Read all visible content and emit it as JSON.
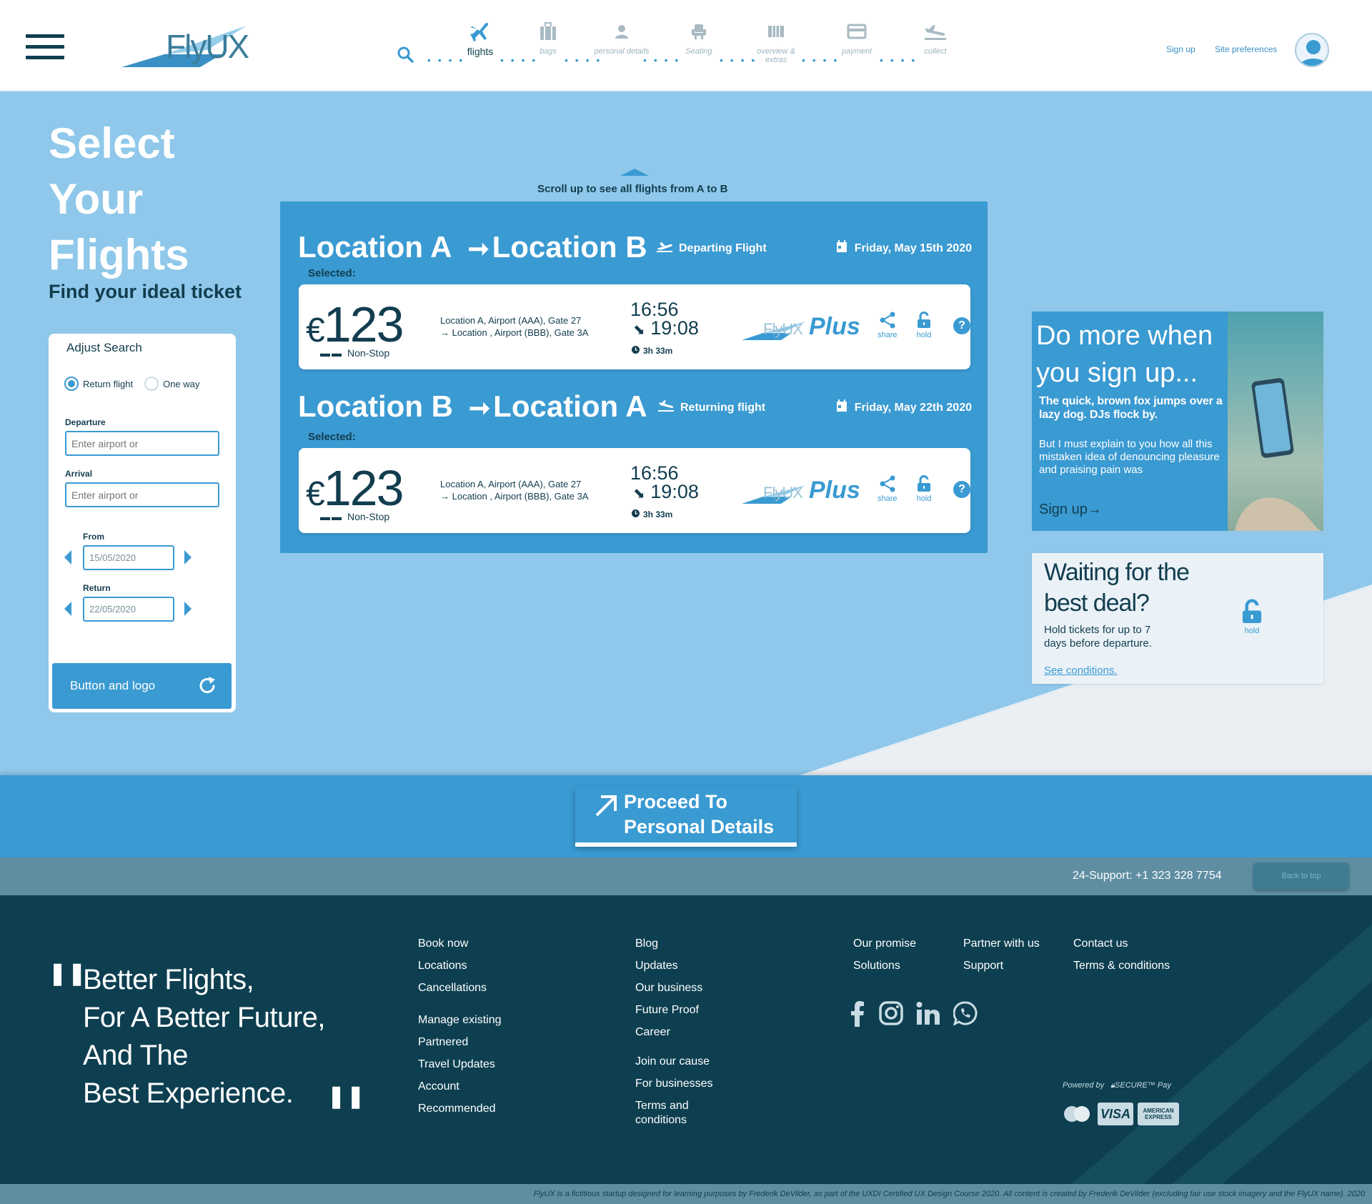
{
  "header": {
    "logo_text": "FlyUX",
    "steps": [
      {
        "label": "flights",
        "icon": "airplane-icon",
        "active": true
      },
      {
        "label": "bags",
        "icon": "luggage-icon",
        "active": false
      },
      {
        "label": "personal details",
        "icon": "person-icon",
        "active": false
      },
      {
        "label": "Seating",
        "icon": "seat-icon",
        "active": false
      },
      {
        "label": "overview & extras",
        "icon": "list-icon",
        "active": false
      },
      {
        "label": "payment",
        "icon": "credit-card-icon",
        "active": false
      },
      {
        "label": "collect",
        "icon": "landing-plane-icon",
        "active": false
      }
    ],
    "sign_up": "Sign up",
    "site_preferences": "Site preferences"
  },
  "intro": {
    "title_lines": [
      "Select",
      "Your",
      "Flights"
    ],
    "subtitle": "Find your ideal ticket"
  },
  "adjust_search": {
    "title": "Adjust Search",
    "trip_types": [
      {
        "label": "Return flight",
        "selected": true
      },
      {
        "label": "One way",
        "selected": false
      }
    ],
    "departure_label": "Departure",
    "departure_placeholder": "Enter airport or",
    "arrival_label": "Arrival",
    "arrival_placeholder": "Enter airport or",
    "from_label": "From",
    "from_value": "15/05/2020",
    "return_label": "Return",
    "return_value": "22/05/2020",
    "button_label": "Button and logo"
  },
  "flights": {
    "scroll_hint": "Scroll up to see all flights from A to B",
    "legs": [
      {
        "from": "Location A",
        "to": "Location B",
        "direction_label": "Departing Flight",
        "date": "Friday, May 15th 2020",
        "selected_label": "Selected:",
        "price_currency": "€",
        "price": "123",
        "stops": "Non-Stop",
        "airport_line_1": "Location A, Airport (AAA), Gate 27",
        "airport_line_2": "→ Location , Airport (BBB), Gate 3A",
        "depart_time": "16:56",
        "arrive_time": "19:08",
        "duration": "3h 33m",
        "brand_plus": "Plus",
        "brand_name": "FlyUX",
        "share_label": "share",
        "hold_label": "hold"
      },
      {
        "from": "Location B",
        "to": "Location A",
        "direction_label": "Returning flight",
        "date": "Friday, May 22th 2020",
        "selected_label": "Selected:",
        "price_currency": "€",
        "price": "123",
        "stops": "Non-Stop",
        "airport_line_1": "Location A, Airport (AAA), Gate 27",
        "airport_line_2": "→ Location , Airport (BBB), Gate 3A",
        "depart_time": "16:56",
        "arrive_time": "19:08",
        "duration": "3h 33m",
        "brand_plus": "Plus",
        "brand_name": "FlyUX",
        "share_label": "share",
        "hold_label": "hold"
      }
    ]
  },
  "promo": {
    "title": "Do more when you sign up...",
    "text_bold": "The quick, brown fox jumps over a lazy dog. DJs flock by.",
    "text": "But I must explain to you how all this mistaken idea of denouncing pleasure and praising pain was",
    "cta": "Sign up→"
  },
  "hold_deal": {
    "title_line_1": "Waiting for the",
    "title_line_2": "best deal?",
    "text": "Hold tickets for up to 7 days before departure.",
    "link": "See conditions.",
    "hold_label": "hold"
  },
  "proceed": {
    "line_1": "Proceed To",
    "line_2": "Personal Details"
  },
  "support": {
    "text": "24-Support: +1 323 328 7754",
    "back_to_top": "Back to top"
  },
  "footer": {
    "quote_lines": [
      "Better Flights,",
      "For A Better Future,",
      "And The",
      "Best Experience."
    ],
    "col1": [
      "Book now",
      "Locations",
      "Cancellations"
    ],
    "col1b": [
      "Manage existing",
      "Partnered",
      "Travel Updates",
      "Account",
      "Recommended"
    ],
    "col2": [
      "Blog",
      "Updates",
      "Our business",
      "Future Proof",
      "Career"
    ],
    "col2b": [
      "Join our cause",
      "For businesses",
      "Terms and conditions"
    ],
    "col3": [
      "Our promise",
      "Solutions"
    ],
    "col4": [
      "Partner with us",
      "Support"
    ],
    "col5": [
      "Contact us",
      "Terms & conditions"
    ],
    "powered_by": "Powered by",
    "secure_pay": "SECURE™ Pay",
    "card_visa": "VISA",
    "card_amex": "AMERICAN EXPRESS",
    "disclaimer": "FlyUX is a fictitious startup designed for learning purposes by Frederik DeVilder, as part of the UXDI Certified UX Design Course 2020. All content is created by Frederik DeVilder (excluding fair use stock imagery and the FlyUX name). 2020"
  },
  "colors": {
    "accent": "#3a9ad2",
    "navy": "#0d3f50",
    "background": "#8fc8ea",
    "support_bar": "#5f8ea2"
  }
}
